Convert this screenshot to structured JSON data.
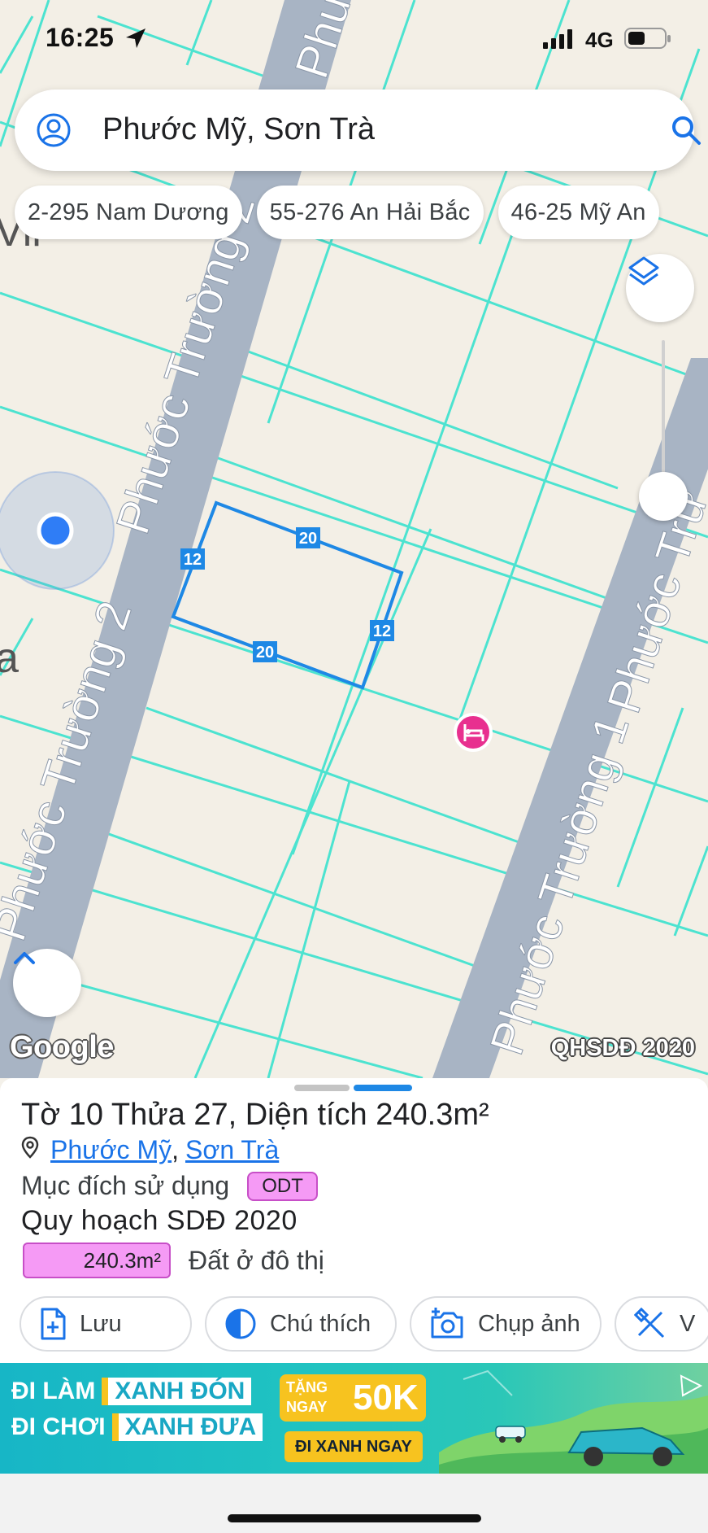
{
  "status_bar": {
    "time": "16:25",
    "network": "4G"
  },
  "search": {
    "query": "Phước Mỹ, Sơn Trà"
  },
  "chips": [
    "2-295 Nam Dương",
    "55-276 An Hải Bắc",
    "46-25 Mỹ An"
  ],
  "map": {
    "streets": [
      "Phước Trường 2",
      "Phước Trường 2",
      "Phước Trường 1",
      "Phước Trư",
      "Phu",
      "Phước Trường 1"
    ],
    "edge_labels": [
      "Vil",
      "a"
    ],
    "parcel_dimensions": {
      "top": "20",
      "right": "12",
      "bottom": "20",
      "left": "12"
    },
    "attribution": "Google",
    "layer": "QHSDĐ 2020",
    "colors": {
      "parcel_lines": "#3ee6cf",
      "road": "#a7b3c3",
      "selection": "#1e88e5",
      "land": "#f3efe6"
    }
  },
  "sheet": {
    "title": {
      "sheet_label": "Tờ",
      "sheet_no": "10",
      "lot_label": "Thửa",
      "lot_no": "27,",
      "area_label": "Diện tích",
      "area": "240.3m²"
    },
    "ward": "Phước Mỹ",
    "separator": ",",
    "district": "Sơn Trà",
    "purpose_label": "Mục đích sử dụng",
    "purpose_code": "ODT",
    "plan_title": "Quy hoạch SDĐ 2020",
    "plan_area": "240.3m²",
    "plan_use": "Đất ở đô thị",
    "plan_color": "#f59af5",
    "actions": [
      "Lưu",
      "Chú thích",
      "Chụp ảnh",
      "V"
    ]
  },
  "ad": {
    "line1_prefix": "ĐI LÀM",
    "line1_box": "XANH ĐÓN",
    "line2_prefix": "ĐI CHƠI",
    "line2_box": "XANH ĐƯA",
    "promo_small": "TẶNG NGAY",
    "promo_big": "50K",
    "cta": "ĐI XANH NGAY"
  }
}
